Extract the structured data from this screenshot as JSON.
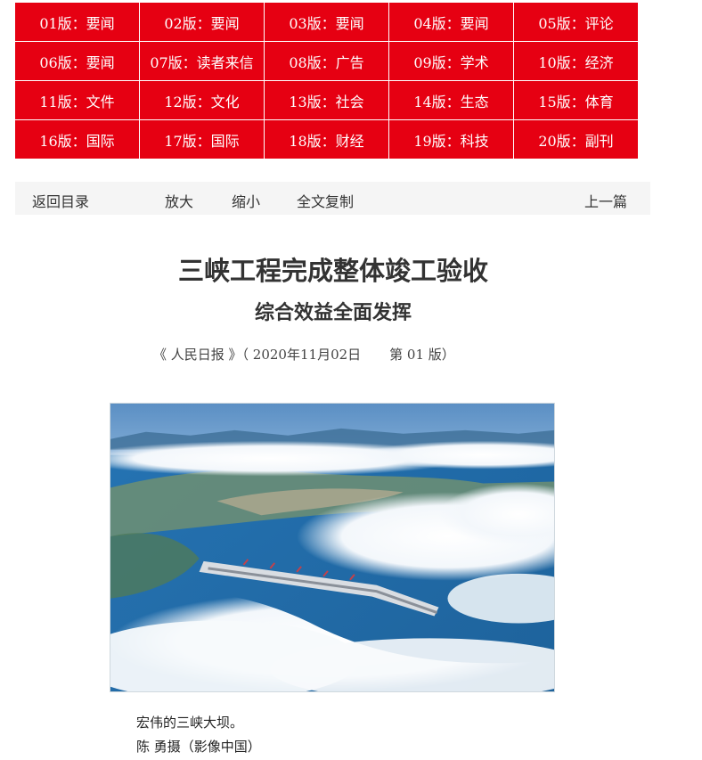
{
  "page_nav": {
    "items": [
      "01版：要闻",
      "02版：要闻",
      "03版：要闻",
      "04版：要闻",
      "05版：评论",
      "06版：要闻",
      "07版：读者来信",
      "08版：广告",
      "09版：学术",
      "10版：经济",
      "11版：文件",
      "12版：文化",
      "13版：社会",
      "14版：生态",
      "15版：体育",
      "16版：国际",
      "17版：国际",
      "18版：财经",
      "19版：科技",
      "20版：副刊"
    ]
  },
  "toolbar": {
    "back": "返回目录",
    "zoom_in": "放大",
    "zoom_out": "缩小",
    "copy_all": "全文复制",
    "prev": "上一篇"
  },
  "article": {
    "title": "三峡工程完成整体竣工验收",
    "subtitle": "综合效益全面发挥",
    "source": "《 人民日报 》（ 2020年11月02日",
    "edition": "第  01 版）"
  },
  "photo": {
    "caption": "宏伟的三峡大坝。",
    "credit": "陈 勇摄（影像中国）"
  },
  "colors": {
    "nav_red": "#e60012",
    "toolbar_bg": "#f5f5f5"
  }
}
